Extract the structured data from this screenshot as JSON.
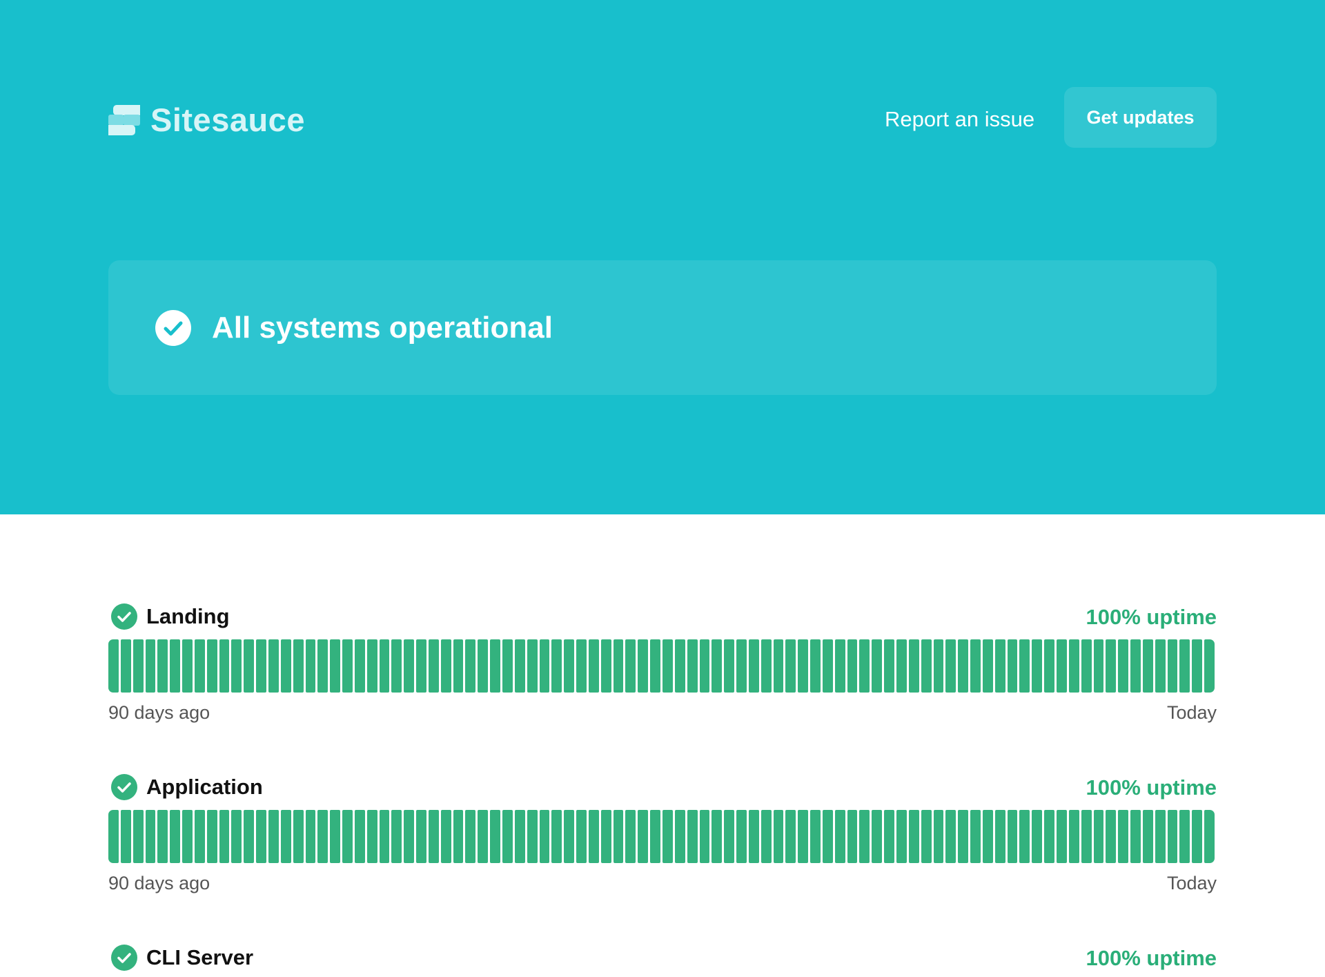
{
  "colors": {
    "hero_bg": "#18BFCC",
    "banner_bg": "#2DC5D0",
    "button_bg": "#32C6D1",
    "logo_text": "#D7F5F7",
    "logo_mark": "#7CDCE4",
    "operational": "#33B27E",
    "uptime_text": "#2AAE78"
  },
  "header": {
    "brand": "Sitesauce",
    "logo_icon": "sitesauce-logo-icon",
    "report_link": "Report an issue",
    "updates_button": "Get updates"
  },
  "status": {
    "icon": "check-circle-icon",
    "title": "All systems operational"
  },
  "components": [
    {
      "name": "Landing",
      "status": "operational",
      "uptime_label": "100% uptime",
      "days": 90,
      "range_start": "90 days ago",
      "range_end": "Today"
    },
    {
      "name": "Application",
      "status": "operational",
      "uptime_label": "100% uptime",
      "days": 90,
      "range_start": "90 days ago",
      "range_end": "Today"
    },
    {
      "name": "CLI Server",
      "status": "operational",
      "uptime_label": "100% uptime"
    }
  ]
}
